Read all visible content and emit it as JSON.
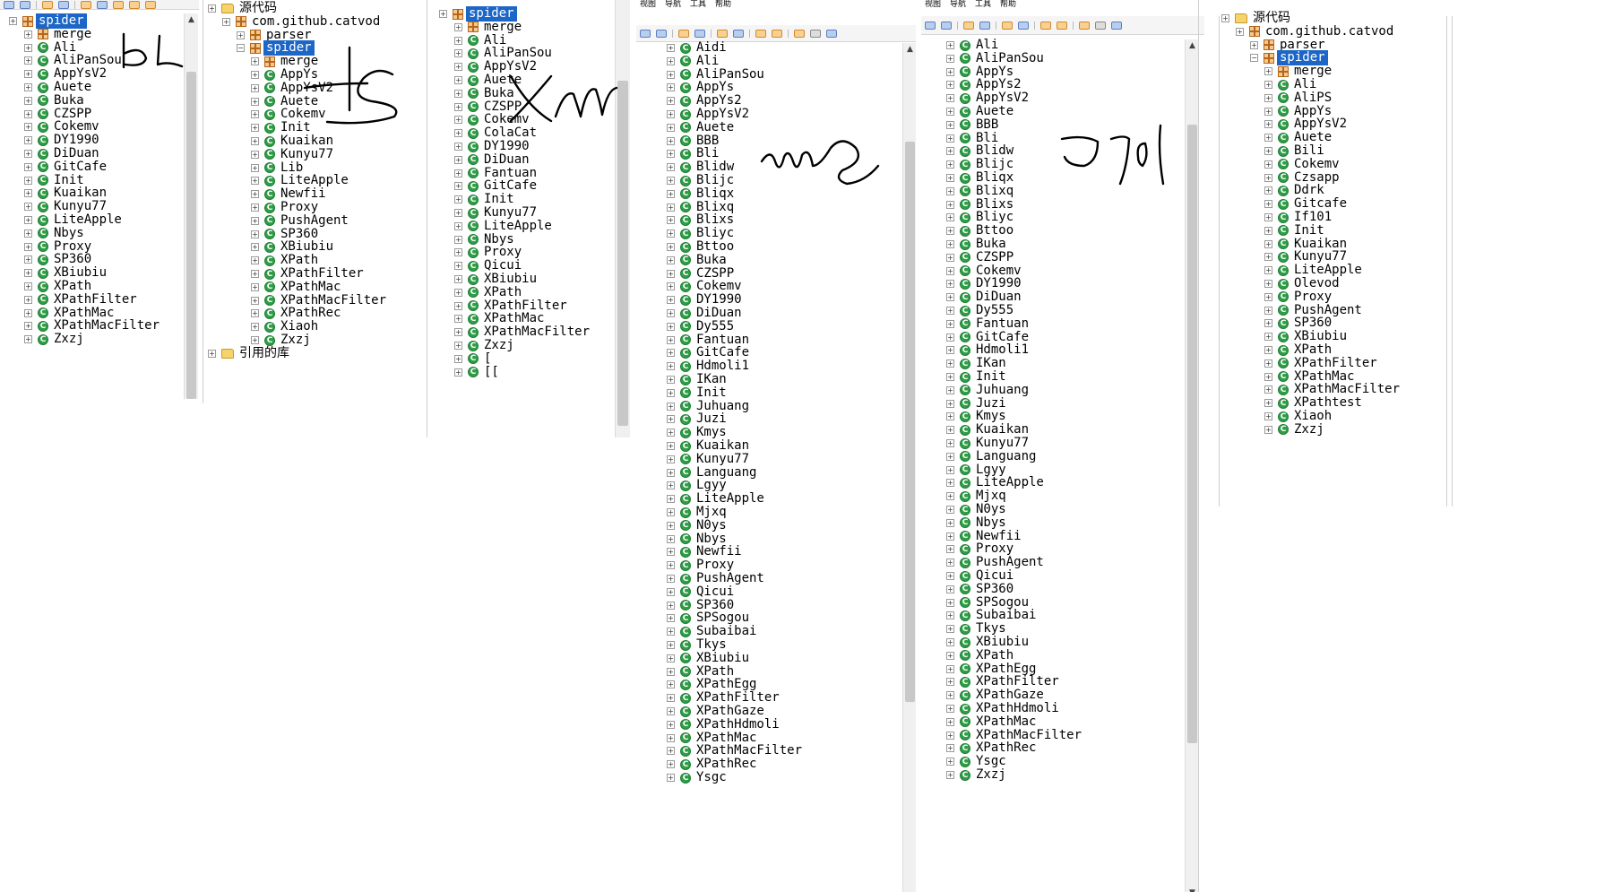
{
  "panel1": {
    "rows": [
      {
        "t": "p",
        "l": "spider",
        "sel": true,
        "lvl": 0
      },
      {
        "t": "p",
        "l": "merge",
        "lvl": 1
      },
      {
        "t": "c",
        "l": "Ali",
        "lvl": 1
      },
      {
        "t": "c",
        "l": "AliPanSou",
        "lvl": 1
      },
      {
        "t": "c",
        "l": "AppYsV2",
        "lvl": 1
      },
      {
        "t": "c",
        "l": "Auete",
        "lvl": 1
      },
      {
        "t": "c",
        "l": "Buka",
        "lvl": 1
      },
      {
        "t": "c",
        "l": "CZSPP",
        "lvl": 1
      },
      {
        "t": "c",
        "l": "Cokemv",
        "lvl": 1
      },
      {
        "t": "c",
        "l": "DY1990",
        "lvl": 1
      },
      {
        "t": "c",
        "l": "DiDuan",
        "lvl": 1
      },
      {
        "t": "c",
        "l": "GitCafe",
        "lvl": 1
      },
      {
        "t": "c",
        "l": "Init",
        "lvl": 1
      },
      {
        "t": "c",
        "l": "Kuaikan",
        "lvl": 1
      },
      {
        "t": "c",
        "l": "Kunyu77",
        "lvl": 1
      },
      {
        "t": "c",
        "l": "LiteApple",
        "lvl": 1
      },
      {
        "t": "c",
        "l": "Nbys",
        "lvl": 1
      },
      {
        "t": "c",
        "l": "Proxy",
        "lvl": 1
      },
      {
        "t": "c",
        "l": "SP360",
        "lvl": 1
      },
      {
        "t": "c",
        "l": "XBiubiu",
        "lvl": 1
      },
      {
        "t": "c",
        "l": "XPath",
        "lvl": 1
      },
      {
        "t": "c",
        "l": "XPathFilter",
        "lvl": 1
      },
      {
        "t": "c",
        "l": "XPathMac",
        "lvl": 1
      },
      {
        "t": "c",
        "l": "XPathMacFilter",
        "lvl": 1
      },
      {
        "t": "c",
        "l": "Zxzj",
        "lvl": 1
      }
    ]
  },
  "panel2": {
    "rows": [
      {
        "t": "f",
        "l": "源代码",
        "lvl": 0
      },
      {
        "t": "p",
        "l": "com.github.catvod",
        "lvl": 1
      },
      {
        "t": "p",
        "l": "parser",
        "lvl": 2
      },
      {
        "t": "p",
        "l": "spider",
        "sel": true,
        "lvl": 2,
        "open": true
      },
      {
        "t": "p",
        "l": "merge",
        "lvl": 3
      },
      {
        "t": "c",
        "l": "AppYs",
        "lvl": 3
      },
      {
        "t": "c",
        "l": "AppYsV2",
        "lvl": 3
      },
      {
        "t": "c",
        "l": "Auete",
        "lvl": 3
      },
      {
        "t": "c",
        "l": "Cokemv",
        "lvl": 3
      },
      {
        "t": "c",
        "l": "Init",
        "lvl": 3
      },
      {
        "t": "c",
        "l": "Kuaikan",
        "lvl": 3
      },
      {
        "t": "c",
        "l": "Kunyu77",
        "lvl": 3
      },
      {
        "t": "c",
        "l": "Lib",
        "lvl": 3
      },
      {
        "t": "c",
        "l": "LiteApple",
        "lvl": 3
      },
      {
        "t": "c",
        "l": "Newfii",
        "lvl": 3
      },
      {
        "t": "c",
        "l": "Proxy",
        "lvl": 3
      },
      {
        "t": "c",
        "l": "PushAgent",
        "lvl": 3
      },
      {
        "t": "c",
        "l": "SP360",
        "lvl": 3
      },
      {
        "t": "c",
        "l": "XBiubiu",
        "lvl": 3
      },
      {
        "t": "c",
        "l": "XPath",
        "lvl": 3
      },
      {
        "t": "c",
        "l": "XPathFilter",
        "lvl": 3
      },
      {
        "t": "c",
        "l": "XPathMac",
        "lvl": 3
      },
      {
        "t": "c",
        "l": "XPathMacFilter",
        "lvl": 3
      },
      {
        "t": "c",
        "l": "XPathRec",
        "lvl": 3
      },
      {
        "t": "c",
        "l": "Xiaoh",
        "lvl": 3
      },
      {
        "t": "c",
        "l": "Zxzj",
        "lvl": 3
      },
      {
        "t": "f",
        "l": "引用的库",
        "lvl": 0
      }
    ]
  },
  "panel3": {
    "rows": [
      {
        "t": "p",
        "l": "spider",
        "sel": true,
        "lvl": 0
      },
      {
        "t": "p",
        "l": "merge",
        "lvl": 1
      },
      {
        "t": "c",
        "l": "Ali",
        "lvl": 1
      },
      {
        "t": "c",
        "l": "AliPanSou",
        "lvl": 1
      },
      {
        "t": "c",
        "l": "AppYsV2",
        "lvl": 1
      },
      {
        "t": "c",
        "l": "Auete",
        "lvl": 1
      },
      {
        "t": "c",
        "l": "Buka",
        "lvl": 1
      },
      {
        "t": "c",
        "l": "CZSPP",
        "lvl": 1
      },
      {
        "t": "c",
        "l": "Cokemv",
        "lvl": 1
      },
      {
        "t": "c",
        "l": "ColaCat",
        "lvl": 1
      },
      {
        "t": "c",
        "l": "DY1990",
        "lvl": 1
      },
      {
        "t": "c",
        "l": "DiDuan",
        "lvl": 1
      },
      {
        "t": "c",
        "l": "Fantuan",
        "lvl": 1
      },
      {
        "t": "c",
        "l": "GitCafe",
        "lvl": 1
      },
      {
        "t": "c",
        "l": "Init",
        "lvl": 1
      },
      {
        "t": "c",
        "l": "Kunyu77",
        "lvl": 1
      },
      {
        "t": "c",
        "l": "LiteApple",
        "lvl": 1
      },
      {
        "t": "c",
        "l": "Nbys",
        "lvl": 1
      },
      {
        "t": "c",
        "l": "Proxy",
        "lvl": 1
      },
      {
        "t": "c",
        "l": "Qicui",
        "lvl": 1
      },
      {
        "t": "c",
        "l": "XBiubiu",
        "lvl": 1
      },
      {
        "t": "c",
        "l": "XPath",
        "lvl": 1
      },
      {
        "t": "c",
        "l": "XPathFilter",
        "lvl": 1
      },
      {
        "t": "c",
        "l": "XPathMac",
        "lvl": 1
      },
      {
        "t": "c",
        "l": "XPathMacFilter",
        "lvl": 1
      },
      {
        "t": "c",
        "l": "Zxzj",
        "lvl": 1
      },
      {
        "t": "c",
        "l": "[",
        "lvl": 1
      },
      {
        "t": "c",
        "l": "[[",
        "lvl": 1
      }
    ]
  },
  "panel4": {
    "menu": [
      "视图",
      "导航",
      "工具",
      "帮助"
    ],
    "rows": [
      {
        "t": "c",
        "l": "Aidi",
        "lvl": 1
      },
      {
        "t": "c",
        "l": "Ali",
        "lvl": 1
      },
      {
        "t": "c",
        "l": "AliPanSou",
        "lvl": 1
      },
      {
        "t": "c",
        "l": "AppYs",
        "lvl": 1
      },
      {
        "t": "c",
        "l": "AppYs2",
        "lvl": 1
      },
      {
        "t": "c",
        "l": "AppYsV2",
        "lvl": 1
      },
      {
        "t": "c",
        "l": "Auete",
        "lvl": 1
      },
      {
        "t": "c",
        "l": "BBB",
        "lvl": 1
      },
      {
        "t": "c",
        "l": "Bli",
        "lvl": 1
      },
      {
        "t": "c",
        "l": "Blidw",
        "lvl": 1
      },
      {
        "t": "c",
        "l": "Blijc",
        "lvl": 1
      },
      {
        "t": "c",
        "l": "Bliqx",
        "lvl": 1
      },
      {
        "t": "c",
        "l": "Blixq",
        "lvl": 1
      },
      {
        "t": "c",
        "l": "Blixs",
        "lvl": 1
      },
      {
        "t": "c",
        "l": "Bliyc",
        "lvl": 1
      },
      {
        "t": "c",
        "l": "Bttoo",
        "lvl": 1
      },
      {
        "t": "c",
        "l": "Buka",
        "lvl": 1
      },
      {
        "t": "c",
        "l": "CZSPP",
        "lvl": 1
      },
      {
        "t": "c",
        "l": "Cokemv",
        "lvl": 1
      },
      {
        "t": "c",
        "l": "DY1990",
        "lvl": 1
      },
      {
        "t": "c",
        "l": "DiDuan",
        "lvl": 1
      },
      {
        "t": "c",
        "l": "Dy555",
        "lvl": 1
      },
      {
        "t": "c",
        "l": "Fantuan",
        "lvl": 1
      },
      {
        "t": "c",
        "l": "GitCafe",
        "lvl": 1
      },
      {
        "t": "c",
        "l": "Hdmoli1",
        "lvl": 1
      },
      {
        "t": "c",
        "l": "IKan",
        "lvl": 1
      },
      {
        "t": "c",
        "l": "Init",
        "lvl": 1
      },
      {
        "t": "c",
        "l": "Juhuang",
        "lvl": 1
      },
      {
        "t": "c",
        "l": "Juzi",
        "lvl": 1
      },
      {
        "t": "c",
        "l": "Kmys",
        "lvl": 1
      },
      {
        "t": "c",
        "l": "Kuaikan",
        "lvl": 1
      },
      {
        "t": "c",
        "l": "Kunyu77",
        "lvl": 1
      },
      {
        "t": "c",
        "l": "Languang",
        "lvl": 1
      },
      {
        "t": "c",
        "l": "Lgyy",
        "lvl": 1
      },
      {
        "t": "c",
        "l": "LiteApple",
        "lvl": 1
      },
      {
        "t": "c",
        "l": "Mjxq",
        "lvl": 1
      },
      {
        "t": "c",
        "l": "N0ys",
        "lvl": 1
      },
      {
        "t": "c",
        "l": "Nbys",
        "lvl": 1
      },
      {
        "t": "c",
        "l": "Newfii",
        "lvl": 1
      },
      {
        "t": "c",
        "l": "Proxy",
        "lvl": 1
      },
      {
        "t": "c",
        "l": "PushAgent",
        "lvl": 1
      },
      {
        "t": "c",
        "l": "Qicui",
        "lvl": 1
      },
      {
        "t": "c",
        "l": "SP360",
        "lvl": 1
      },
      {
        "t": "c",
        "l": "SPSogou",
        "lvl": 1
      },
      {
        "t": "c",
        "l": "Subaibai",
        "lvl": 1
      },
      {
        "t": "c",
        "l": "Tkys",
        "lvl": 1
      },
      {
        "t": "c",
        "l": "XBiubiu",
        "lvl": 1
      },
      {
        "t": "c",
        "l": "XPath",
        "lvl": 1
      },
      {
        "t": "c",
        "l": "XPathEgg",
        "lvl": 1
      },
      {
        "t": "c",
        "l": "XPathFilter",
        "lvl": 1
      },
      {
        "t": "c",
        "l": "XPathGaze",
        "lvl": 1
      },
      {
        "t": "c",
        "l": "XPathHdmoli",
        "lvl": 1
      },
      {
        "t": "c",
        "l": "XPathMac",
        "lvl": 1
      },
      {
        "t": "c",
        "l": "XPathMacFilter",
        "lvl": 1
      },
      {
        "t": "c",
        "l": "XPathRec",
        "lvl": 1
      },
      {
        "t": "c",
        "l": "Ysgc",
        "lvl": 1
      }
    ]
  },
  "panel5": {
    "menu": [
      "视图",
      "导航",
      "工具",
      "帮助"
    ],
    "rows": [
      {
        "t": "c",
        "l": "Ali",
        "lvl": 1
      },
      {
        "t": "c",
        "l": "AliPanSou",
        "lvl": 1
      },
      {
        "t": "c",
        "l": "AppYs",
        "lvl": 1
      },
      {
        "t": "c",
        "l": "AppYs2",
        "lvl": 1
      },
      {
        "t": "c",
        "l": "AppYsV2",
        "lvl": 1
      },
      {
        "t": "c",
        "l": "Auete",
        "lvl": 1
      },
      {
        "t": "c",
        "l": "BBB",
        "lvl": 1
      },
      {
        "t": "c",
        "l": "Bli",
        "lvl": 1
      },
      {
        "t": "c",
        "l": "Blidw",
        "lvl": 1
      },
      {
        "t": "c",
        "l": "Blijc",
        "lvl": 1
      },
      {
        "t": "c",
        "l": "Bliqx",
        "lvl": 1
      },
      {
        "t": "c",
        "l": "Blixq",
        "lvl": 1
      },
      {
        "t": "c",
        "l": "Blixs",
        "lvl": 1
      },
      {
        "t": "c",
        "l": "Bliyc",
        "lvl": 1
      },
      {
        "t": "c",
        "l": "Bttoo",
        "lvl": 1
      },
      {
        "t": "c",
        "l": "Buka",
        "lvl": 1
      },
      {
        "t": "c",
        "l": "CZSPP",
        "lvl": 1
      },
      {
        "t": "c",
        "l": "Cokemv",
        "lvl": 1
      },
      {
        "t": "c",
        "l": "DY1990",
        "lvl": 1
      },
      {
        "t": "c",
        "l": "DiDuan",
        "lvl": 1
      },
      {
        "t": "c",
        "l": "Dy555",
        "lvl": 1
      },
      {
        "t": "c",
        "l": "Fantuan",
        "lvl": 1
      },
      {
        "t": "c",
        "l": "GitCafe",
        "lvl": 1
      },
      {
        "t": "c",
        "l": "Hdmoli1",
        "lvl": 1
      },
      {
        "t": "c",
        "l": "IKan",
        "lvl": 1
      },
      {
        "t": "c",
        "l": "Init",
        "lvl": 1
      },
      {
        "t": "c",
        "l": "Juhuang",
        "lvl": 1
      },
      {
        "t": "c",
        "l": "Juzi",
        "lvl": 1
      },
      {
        "t": "c",
        "l": "Kmys",
        "lvl": 1
      },
      {
        "t": "c",
        "l": "Kuaikan",
        "lvl": 1
      },
      {
        "t": "c",
        "l": "Kunyu77",
        "lvl": 1
      },
      {
        "t": "c",
        "l": "Languang",
        "lvl": 1
      },
      {
        "t": "c",
        "l": "Lgyy",
        "lvl": 1
      },
      {
        "t": "c",
        "l": "LiteApple",
        "lvl": 1
      },
      {
        "t": "c",
        "l": "Mjxq",
        "lvl": 1
      },
      {
        "t": "c",
        "l": "N0ys",
        "lvl": 1
      },
      {
        "t": "c",
        "l": "Nbys",
        "lvl": 1
      },
      {
        "t": "c",
        "l": "Newfii",
        "lvl": 1
      },
      {
        "t": "c",
        "l": "Proxy",
        "lvl": 1
      },
      {
        "t": "c",
        "l": "PushAgent",
        "lvl": 1
      },
      {
        "t": "c",
        "l": "Qicui",
        "lvl": 1
      },
      {
        "t": "c",
        "l": "SP360",
        "lvl": 1
      },
      {
        "t": "c",
        "l": "SPSogou",
        "lvl": 1
      },
      {
        "t": "c",
        "l": "Subaibai",
        "lvl": 1
      },
      {
        "t": "c",
        "l": "Tkys",
        "lvl": 1
      },
      {
        "t": "c",
        "l": "XBiubiu",
        "lvl": 1
      },
      {
        "t": "c",
        "l": "XPath",
        "lvl": 1
      },
      {
        "t": "c",
        "l": "XPathEgg",
        "lvl": 1
      },
      {
        "t": "c",
        "l": "XPathFilter",
        "lvl": 1
      },
      {
        "t": "c",
        "l": "XPathGaze",
        "lvl": 1
      },
      {
        "t": "c",
        "l": "XPathHdmoli",
        "lvl": 1
      },
      {
        "t": "c",
        "l": "XPathMac",
        "lvl": 1
      },
      {
        "t": "c",
        "l": "XPathMacFilter",
        "lvl": 1
      },
      {
        "t": "c",
        "l": "XPathRec",
        "lvl": 1
      },
      {
        "t": "c",
        "l": "Ysgc",
        "lvl": 1
      },
      {
        "t": "c",
        "l": "Zxzj",
        "lvl": 1
      }
    ]
  },
  "panel6": {
    "rows": [
      {
        "t": "f",
        "l": "源代码",
        "lvl": 0
      },
      {
        "t": "p",
        "l": "com.github.catvod",
        "lvl": 1
      },
      {
        "t": "p",
        "l": "parser",
        "lvl": 2
      },
      {
        "t": "p",
        "l": "spider",
        "sel": true,
        "lvl": 2,
        "open": true
      },
      {
        "t": "p",
        "l": "merge",
        "lvl": 3
      },
      {
        "t": "c",
        "l": "Ali",
        "lvl": 3
      },
      {
        "t": "c",
        "l": "AliPS",
        "lvl": 3
      },
      {
        "t": "c",
        "l": "AppYs",
        "lvl": 3
      },
      {
        "t": "c",
        "l": "AppYsV2",
        "lvl": 3
      },
      {
        "t": "c",
        "l": "Auete",
        "lvl": 3
      },
      {
        "t": "c",
        "l": "Bili",
        "lvl": 3
      },
      {
        "t": "c",
        "l": "Cokemv",
        "lvl": 3
      },
      {
        "t": "c",
        "l": "Czsapp",
        "lvl": 3
      },
      {
        "t": "c",
        "l": "Ddrk",
        "lvl": 3
      },
      {
        "t": "c",
        "l": "Gitcafe",
        "lvl": 3
      },
      {
        "t": "c",
        "l": "If101",
        "lvl": 3
      },
      {
        "t": "c",
        "l": "Init",
        "lvl": 3
      },
      {
        "t": "c",
        "l": "Kuaikan",
        "lvl": 3
      },
      {
        "t": "c",
        "l": "Kunyu77",
        "lvl": 3
      },
      {
        "t": "c",
        "l": "LiteApple",
        "lvl": 3
      },
      {
        "t": "c",
        "l": "Olevod",
        "lvl": 3
      },
      {
        "t": "c",
        "l": "Proxy",
        "lvl": 3
      },
      {
        "t": "c",
        "l": "PushAgent",
        "lvl": 3
      },
      {
        "t": "c",
        "l": "SP360",
        "lvl": 3
      },
      {
        "t": "c",
        "l": "XBiubiu",
        "lvl": 3
      },
      {
        "t": "c",
        "l": "XPath",
        "lvl": 3
      },
      {
        "t": "c",
        "l": "XPathFilter",
        "lvl": 3
      },
      {
        "t": "c",
        "l": "XPathMac",
        "lvl": 3
      },
      {
        "t": "c",
        "l": "XPathMacFilter",
        "lvl": 3
      },
      {
        "t": "c",
        "l": "XPathtest",
        "lvl": 3
      },
      {
        "t": "c",
        "l": "Xiaoh",
        "lvl": 3
      },
      {
        "t": "c",
        "l": "Zxzj",
        "lvl": 3
      }
    ]
  }
}
